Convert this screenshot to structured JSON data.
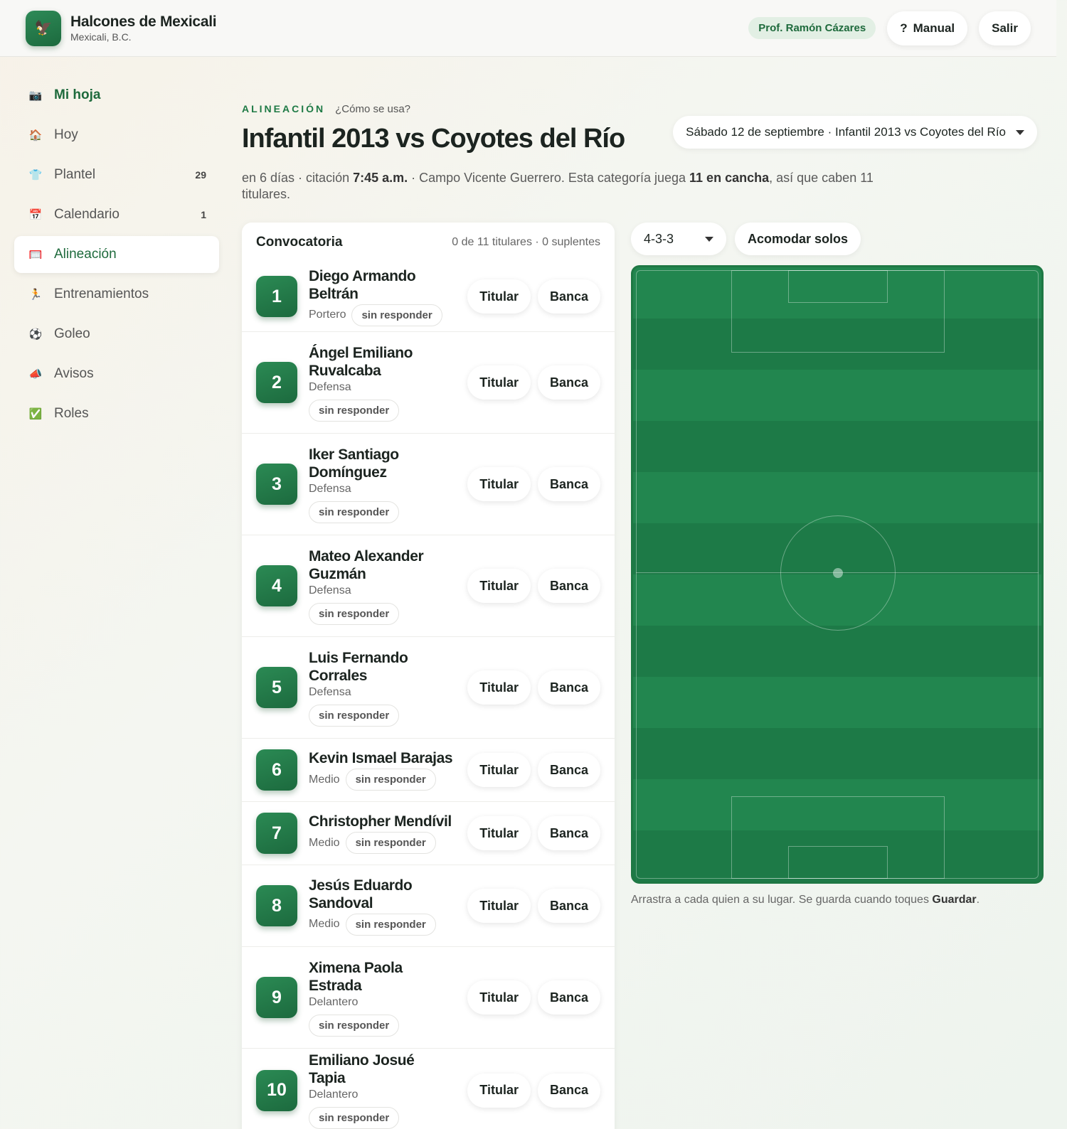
{
  "brand": {
    "name": "Halcones de Mexicali",
    "location": "Mexicali, B.C."
  },
  "header": {
    "user": "Prof. Ramón Cázares",
    "manual_icon": "?",
    "manual_label": "Manual",
    "logout_label": "Salir"
  },
  "sidebar": {
    "items": [
      {
        "icon": "📷",
        "label": "Mi hoja",
        "badge": ""
      },
      {
        "icon": "🏠",
        "label": "Hoy",
        "badge": ""
      },
      {
        "icon": "👕",
        "label": "Plantel",
        "badge": "29"
      },
      {
        "icon": "📅",
        "label": "Calendario",
        "badge": "1"
      },
      {
        "icon": "🥅",
        "label": "Alineación",
        "badge": ""
      },
      {
        "icon": "🏃",
        "label": "Entrenamientos",
        "badge": ""
      },
      {
        "icon": "⚽",
        "label": "Goleo",
        "badge": ""
      },
      {
        "icon": "📣",
        "label": "Avisos",
        "badge": ""
      },
      {
        "icon": "✅",
        "label": "Roles",
        "badge": ""
      }
    ]
  },
  "page": {
    "eyebrow": "ALINEACIÓN",
    "help_link": "¿Cómo se usa?",
    "title": "Infantil 2013 vs Coyotes del Río",
    "match_select": "Sábado 12 de septiembre · Infantil 2013 vs Coyotes del Río",
    "summary": {
      "p1": "en 6 días · citación ",
      "time": "7:45 a.m.",
      "p2": " · Campo Vicente Guerrero. Esta categoría juega ",
      "count": "11 en cancha",
      "p3": ", así que caben 11 titulares."
    }
  },
  "roster": {
    "title": "Convocatoria",
    "count": "0 de 11 titulares · 0 suplentes",
    "starter_label": "Titular",
    "bench_label": "Banca",
    "players": [
      {
        "number": "1",
        "name": "Diego Armando Beltrán",
        "position": "Portero",
        "status": "sin responder"
      },
      {
        "number": "2",
        "name": "Ángel Emiliano Ruvalcaba",
        "position": "Defensa",
        "status": "sin responder"
      },
      {
        "number": "3",
        "name": "Iker Santiago Domínguez",
        "position": "Defensa",
        "status": "sin responder"
      },
      {
        "number": "4",
        "name": "Mateo Alexander Guzmán",
        "position": "Defensa",
        "status": "sin responder"
      },
      {
        "number": "5",
        "name": "Luis Fernando Corrales",
        "position": "Defensa",
        "status": "sin responder"
      },
      {
        "number": "6",
        "name": "Kevin Ismael Barajas",
        "position": "Medio",
        "status": "sin responder"
      },
      {
        "number": "7",
        "name": "Christopher Mendívil",
        "position": "Medio",
        "status": "sin responder"
      },
      {
        "number": "8",
        "name": "Jesús Eduardo Sandoval",
        "position": "Medio",
        "status": "sin responder"
      },
      {
        "number": "9",
        "name": "Ximena Paola Estrada",
        "position": "Delantero",
        "status": "sin responder"
      },
      {
        "number": "10",
        "name": "Emiliano Josué Tapia",
        "position": "Delantero",
        "status": "sin responder"
      }
    ]
  },
  "field": {
    "formation": "4-3-3",
    "auto_label": "Acomodar solos",
    "note_p1": "Arrastra a cada quien a su lugar. Se guarda cuando toques ",
    "note_bold": "Guardar",
    "note_p2": "."
  }
}
